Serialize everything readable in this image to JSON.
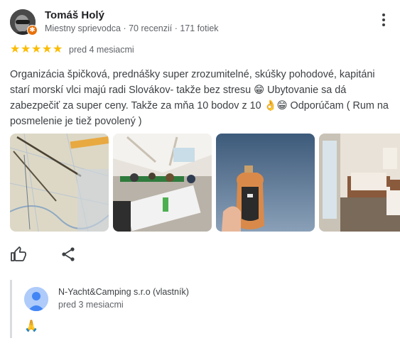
{
  "reviewer": {
    "name": "Tomáš Holý",
    "meta": "Miestny sprievodca · 70 recenzií · 171 fotiek",
    "avatar_icon": "profile-photo",
    "badge_icon": "local-guide-star-icon"
  },
  "rating": {
    "value": 5,
    "max": 5,
    "star_color": "#fbbc04"
  },
  "date": "pred 4 mesiacmi",
  "review_text": "Organizácia špičková, prednášky super zrozumitelné, skúšky pohodové, kapitáni starí morskí vlci majú radi Slovákov- takže bez stresu 😁 Ubytovanie sa dá zabezpečiť za super ceny. Takže za mňa 10 bodov z 10 👌😁 Odporúčam ( Rum na posmelenie je tiež povolený )",
  "photos": [
    {
      "name": "photo-nautical-chart"
    },
    {
      "name": "photo-classroom"
    },
    {
      "name": "photo-rum-bottle"
    },
    {
      "name": "photo-bedroom"
    }
  ],
  "actions": {
    "like_icon": "thumbs-up-icon",
    "share_icon": "share-icon"
  },
  "owner_response": {
    "name": "N-Yacht&Camping s.r.o (vlastník)",
    "date": "pred 3 mesiacmi",
    "text": "🙏"
  }
}
